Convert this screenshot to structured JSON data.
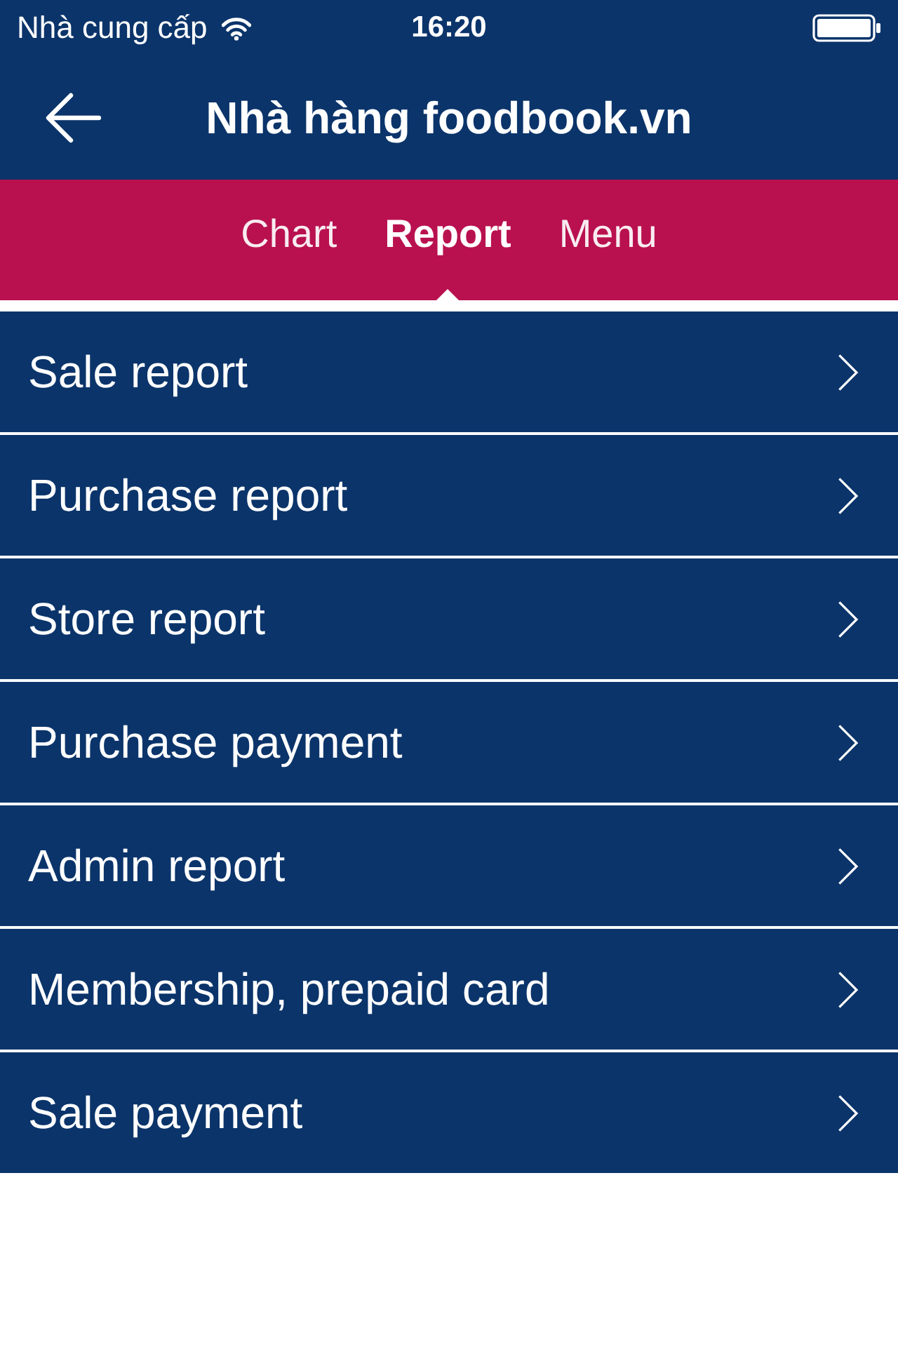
{
  "status_bar": {
    "carrier": "Nhà cung cấp",
    "time": "16:20"
  },
  "nav_bar": {
    "title": "Nhà hàng foodbook.vn"
  },
  "tabs": [
    {
      "label": "Chart",
      "selected": false
    },
    {
      "label": "Report",
      "selected": true
    },
    {
      "label": "Menu",
      "selected": false
    }
  ],
  "menu_items": [
    {
      "label": "Sale report"
    },
    {
      "label": "Purchase report"
    },
    {
      "label": "Store report"
    },
    {
      "label": "Purchase payment"
    },
    {
      "label": "Admin report"
    },
    {
      "label": "Membership, prepaid card"
    },
    {
      "label": "Sale payment"
    }
  ]
}
